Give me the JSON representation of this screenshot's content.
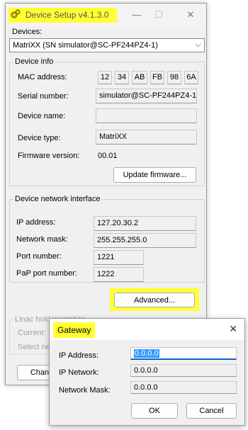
{
  "window": {
    "title": "Device Setup  v4.1.3.0",
    "minimize_glyph": "—",
    "maximize_glyph": "☐",
    "close_glyph": "✕"
  },
  "devices": {
    "label": "Devices:",
    "selected": "MatriXX (SN simulator@SC-PF244PZ4-1)"
  },
  "device_info": {
    "group_label": "Device info",
    "mac_label": "MAC address:",
    "mac": [
      "12",
      "34",
      "AB",
      "FB",
      "98",
      "6A"
    ],
    "serial_label": "Serial number:",
    "serial_value": "simulator@SC-PF244PZ4-1",
    "name_label": "Device name:",
    "name_value": "",
    "type_label": "Device type:",
    "type_value": "MatriXX",
    "firmware_label": "Firmware version:",
    "firmware_value": "00.01",
    "update_button": "Update firmware..."
  },
  "network": {
    "group_label": "Device network interface",
    "ip_label": "IP address:",
    "ip_value": "127.20.30.2",
    "mask_label": "Network mask:",
    "mask_value": "255.255.255.0",
    "port_label": "Port number:",
    "port_value": "1221",
    "pap_label": "PaP port number:",
    "pap_value": "1222",
    "advanced_button": "Advanced..."
  },
  "linac": {
    "group_label": "Linac holder rotation",
    "current_label": "Current:",
    "select_label": "Select ne",
    "change_button": "Chang"
  },
  "gateway_dialog": {
    "title": "Gateway",
    "ip_label": "IP Address:",
    "ip_value": "0.0.0.0",
    "network_label": "IP Network:",
    "network_value": "0.0.0.0",
    "mask_label": "Network Mask:",
    "mask_value": "0.0.0.0",
    "ok_button": "OK",
    "cancel_button": "Cancel"
  },
  "colors": {
    "highlight": "#ffff33",
    "focus_accent": "#0b63c7"
  }
}
